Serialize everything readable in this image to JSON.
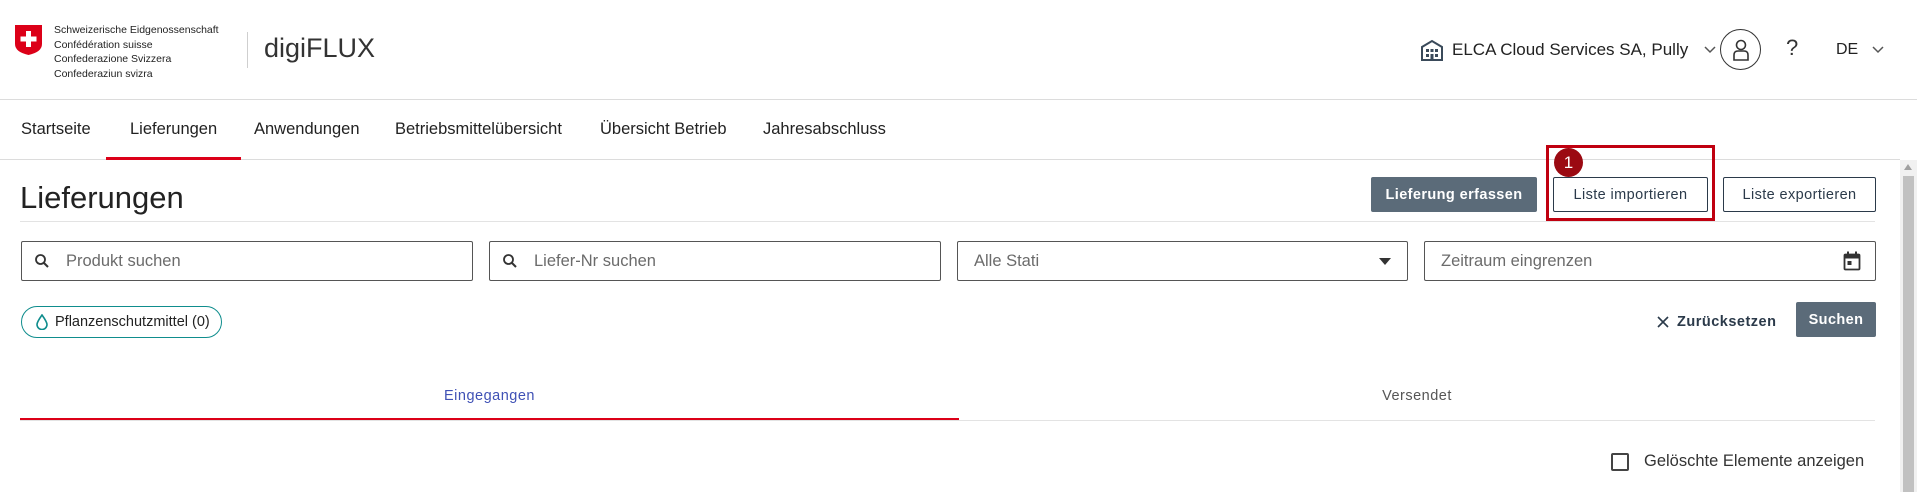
{
  "header": {
    "confederation_lines": [
      "Schweizerische Eidgenossenschaft",
      "Confédération suisse",
      "Confederazione Svizzera",
      "Confederaziun svizra"
    ],
    "app_title": "digiFLUX",
    "organization": "ELCA Cloud Services SA, Pully",
    "help_label": "?",
    "language": "DE",
    "colors": {
      "flag_red": "#dc0018"
    }
  },
  "nav": {
    "items": [
      {
        "label": "Startseite"
      },
      {
        "label": "Lieferungen"
      },
      {
        "label": "Anwendungen"
      },
      {
        "label": "Betriebsmittelübersicht"
      },
      {
        "label": "Übersicht Betrieb"
      },
      {
        "label": "Jahresabschluss"
      }
    ],
    "active": "Lieferungen"
  },
  "page": {
    "title": "Lieferungen",
    "actions": {
      "create": "Lieferung erfassen",
      "import": "Liste importieren",
      "export": "Liste exportieren"
    },
    "annotation_badge": "1"
  },
  "filters": {
    "product_placeholder": "Produkt suchen",
    "delivery_no_placeholder": "Liefer-Nr suchen",
    "status_value": "Alle Stati",
    "period_placeholder": "Zeitraum eingrenzen",
    "chip": "Pflanzenschutzmittel (0)",
    "reset": "Zurücksetzen",
    "search": "Suchen"
  },
  "tabs": {
    "received": "Eingegangen",
    "sent": "Versendet",
    "active": "Eingegangen"
  },
  "options": {
    "show_deleted_label": "Gelöschte Elemente anzeigen",
    "show_deleted_checked": false
  }
}
